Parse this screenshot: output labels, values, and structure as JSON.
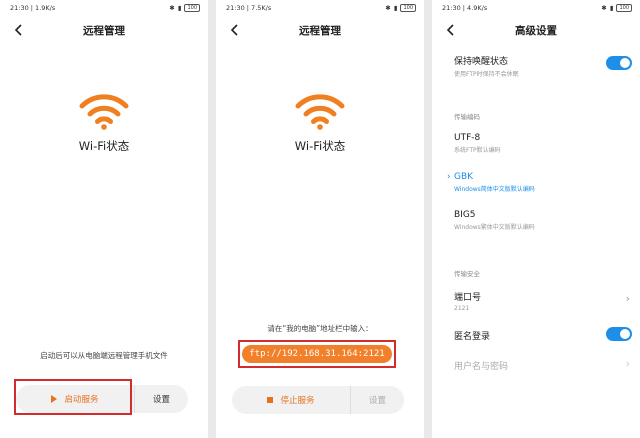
{
  "screen1": {
    "status": {
      "time": "21:30 | 1.9K/s",
      "battery": "100"
    },
    "title": "远程管理",
    "wifi_label": "Wi-Fi状态",
    "hint": "启动后可以从电脑端远程管理手机文件",
    "start_label": "启动服务",
    "settings_label": "设置"
  },
  "screen2": {
    "status": {
      "time": "21:30 | 7.5K/s",
      "battery": "100"
    },
    "title": "远程管理",
    "wifi_label": "Wi-Fi状态",
    "hint": "请在“我的电脑”地址栏中输入：",
    "ftp_address": "ftp://192.168.31.164:2121",
    "stop_label": "停止服务",
    "settings_label": "设置"
  },
  "screen3": {
    "status": {
      "time": "21:30 | 4.9K/s",
      "battery": "100"
    },
    "title": "高级设置",
    "keep_awake": {
      "title": "保持唤醒状态",
      "subtitle": "使用FTP时保持不会休眠",
      "enabled": true
    },
    "encoding_section": "传输编码",
    "encodings": [
      {
        "title": "UTF-8",
        "subtitle": "系统FTP默认编码",
        "selected": false
      },
      {
        "title": "GBK",
        "subtitle": "Windows简体中文版默认编码",
        "selected": true
      },
      {
        "title": "BIG5",
        "subtitle": "Windows繁体中文版默认编码",
        "selected": false
      }
    ],
    "security_section": "传输安全",
    "port": {
      "title": "端口号",
      "value": "2121"
    },
    "anonymous": {
      "title": "匿名登录",
      "enabled": true
    },
    "credentials": {
      "title": "用户名与密码"
    }
  },
  "colors": {
    "accent_orange": "#e8711f",
    "accent_blue": "#1e8fe8",
    "highlight_red": "#d22c2c"
  },
  "icons": [
    "back-arrow-icon",
    "wifi-icon",
    "play-icon",
    "stop-icon",
    "chevron-right-icon",
    "toggle-switch"
  ]
}
